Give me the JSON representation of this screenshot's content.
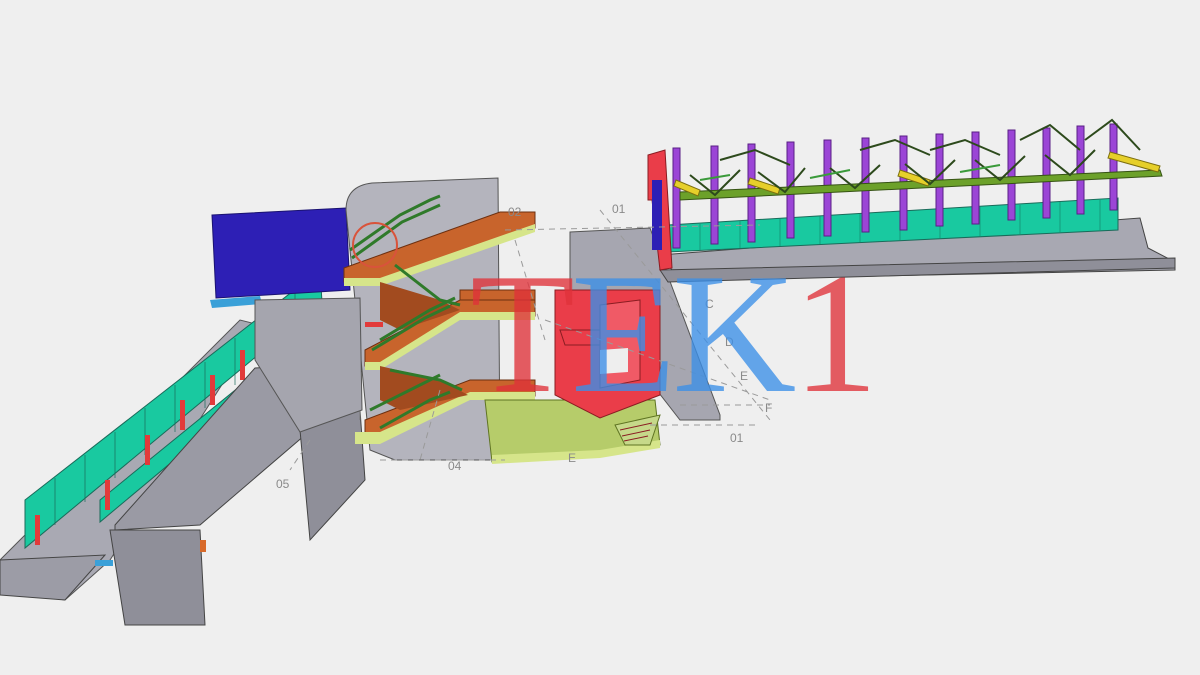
{
  "scene": {
    "grid_labels": {
      "g1": "01",
      "g2": "02",
      "g3": "C",
      "g4": "D",
      "g5": "E",
      "g6": "F",
      "g7": "01",
      "g8": "04",
      "g9": "05",
      "g10": "E"
    }
  },
  "watermark": {
    "letters": [
      "T",
      "E",
      "K",
      "1"
    ],
    "colors": [
      "#e0323a",
      "#3b8fe8",
      "#3b8fe8",
      "#e0323a"
    ]
  }
}
